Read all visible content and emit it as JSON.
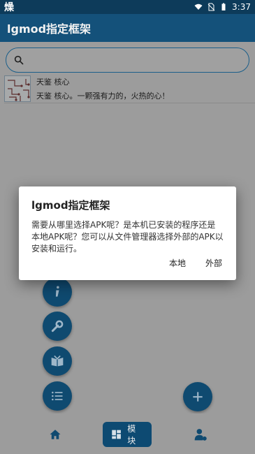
{
  "status_bar": {
    "left_text": "燥",
    "time": "3:37"
  },
  "app_bar": {
    "title": "lgmod指定框架"
  },
  "search": {
    "placeholder": ""
  },
  "module": {
    "title": "天鉴 核心",
    "description": "天鉴 核心。一颗强有力的，火热的心！"
  },
  "dialog": {
    "title": "lgmod指定框架",
    "message": "需要从哪里选择APK呢？是本机已安装的程序还是本地APK呢？您可以从文件管理器选择外部的APK以安装和运行。",
    "btn_local": "本地",
    "btn_external": "外部"
  },
  "bottom_nav": {
    "selected_label": "模块"
  },
  "colors": {
    "primary": "#14517a",
    "primary_dark": "#0d3b5a",
    "fab": "#0f4a70"
  }
}
